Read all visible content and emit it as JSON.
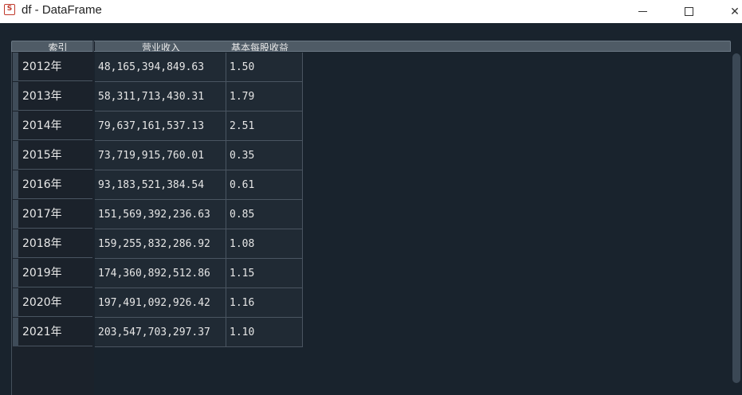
{
  "window": {
    "title": "df - DataFrame",
    "minimize_label": "",
    "maximize_label": "",
    "close_label": "✕"
  },
  "table": {
    "headers": [
      "索引",
      "营业收入",
      "基本每股收益"
    ],
    "rows": [
      {
        "index": "2012年",
        "revenue": "48,165,394,849.63",
        "eps": "1.50"
      },
      {
        "index": "2013年",
        "revenue": "58,311,713,430.31",
        "eps": "1.79"
      },
      {
        "index": "2014年",
        "revenue": "79,637,161,537.13",
        "eps": "2.51"
      },
      {
        "index": "2015年",
        "revenue": "73,719,915,760.01",
        "eps": "0.35"
      },
      {
        "index": "2016年",
        "revenue": "93,183,521,384.54",
        "eps": "0.61"
      },
      {
        "index": "2017年",
        "revenue": "151,569,392,236.63",
        "eps": "0.85"
      },
      {
        "index": "2018年",
        "revenue": "159,255,832,286.92",
        "eps": "1.08"
      },
      {
        "index": "2019年",
        "revenue": "174,360,892,512.86",
        "eps": "1.15"
      },
      {
        "index": "2020年",
        "revenue": "197,491,092,926.42",
        "eps": "1.16"
      },
      {
        "index": "2021年",
        "revenue": "203,547,703,297.37",
        "eps": "1.10"
      }
    ]
  }
}
